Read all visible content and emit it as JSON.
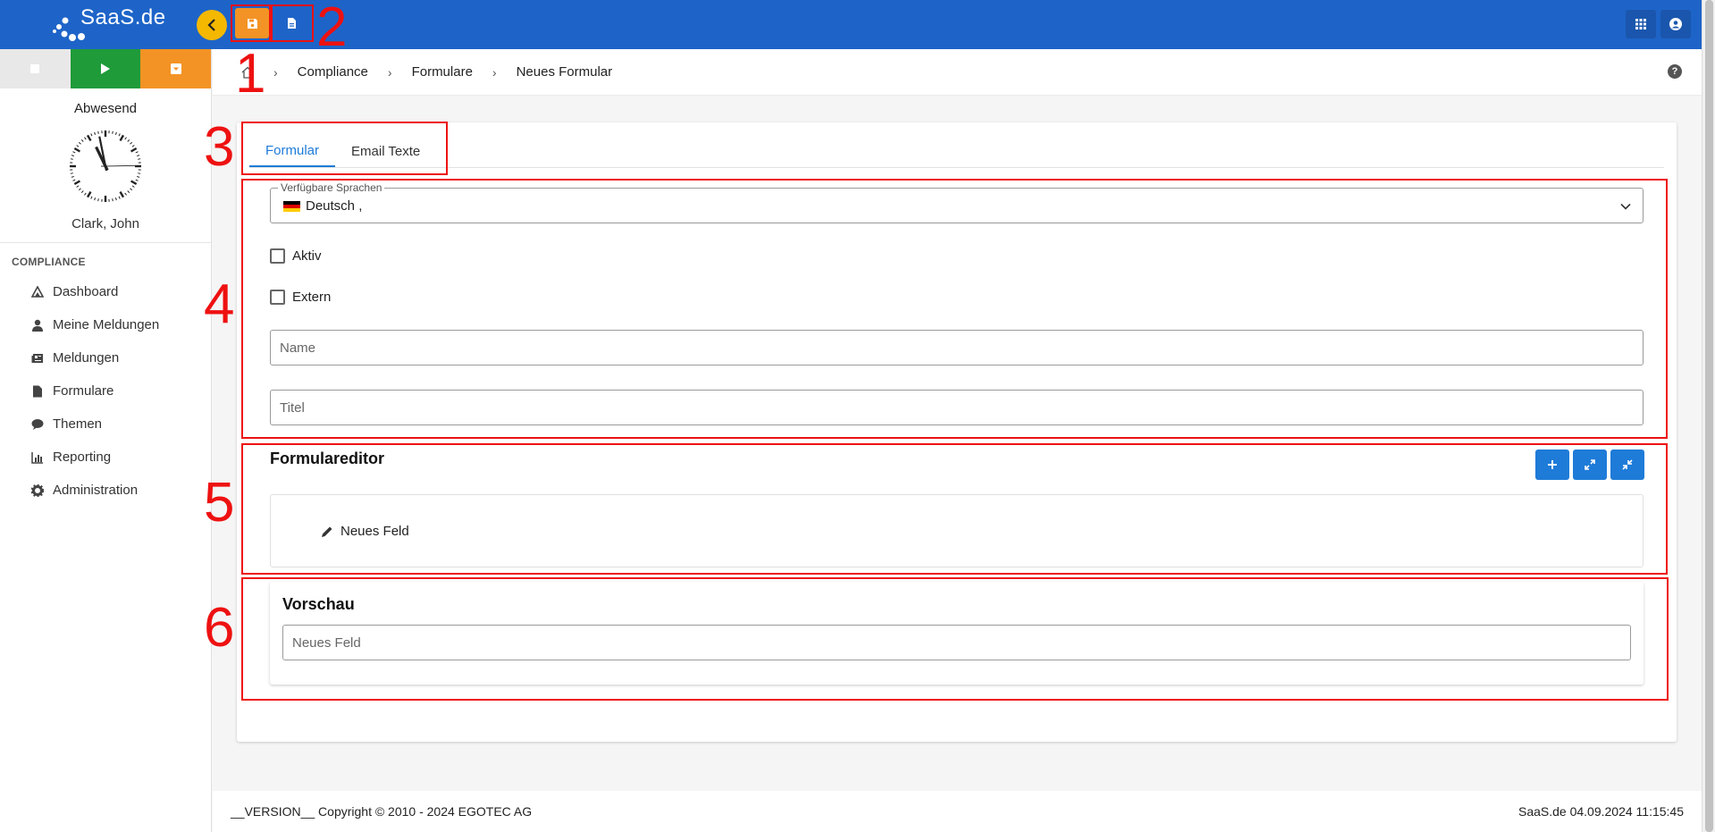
{
  "brand": {
    "logo_text": "SaaS.de"
  },
  "status": {
    "label": "Abwesend",
    "user": "Clark, John"
  },
  "sidebar": {
    "section": "COMPLIANCE",
    "items": [
      {
        "label": "Dashboard"
      },
      {
        "label": "Meine Meldungen"
      },
      {
        "label": "Meldungen"
      },
      {
        "label": "Formulare"
      },
      {
        "label": "Themen"
      },
      {
        "label": "Reporting"
      },
      {
        "label": "Administration"
      }
    ]
  },
  "breadcrumb": {
    "items": [
      "Compliance",
      "Formulare",
      "Neues Formular"
    ],
    "help": "?"
  },
  "tabs": [
    {
      "label": "Formular"
    },
    {
      "label": "Email Texte"
    }
  ],
  "form": {
    "languages_label": "Verfügbare Sprachen",
    "languages_value": "Deutsch ,",
    "aktiv_label": "Aktiv",
    "extern_label": "Extern",
    "name_placeholder": "Name",
    "titel_placeholder": "Titel"
  },
  "editor": {
    "title": "Formulareditor",
    "field_label": "Neues Feld"
  },
  "preview": {
    "title": "Vorschau",
    "field_placeholder": "Neues Feld"
  },
  "footer": {
    "left": "__VERSION__ Copyright © 2010 - 2024 EGOTEC AG",
    "right": "SaaS.de  04.09.2024 11:15:45"
  },
  "annotations": {
    "labels": [
      "1",
      "2",
      "3",
      "4",
      "5",
      "6"
    ],
    "color": "#ee1111"
  },
  "colors": {
    "topbar": "#1e64c8",
    "accent": "#f39325",
    "play": "#1f9b3a",
    "link": "#1e7bd8"
  }
}
